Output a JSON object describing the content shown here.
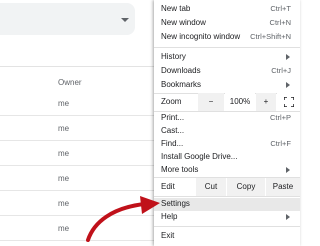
{
  "background": {
    "owner_header": "Owner",
    "rows": [
      "me",
      "me",
      "me",
      "me",
      "me",
      "me"
    ]
  },
  "menu": {
    "new_tab": {
      "label": "New tab",
      "shortcut": "Ctrl+T"
    },
    "new_window": {
      "label": "New window",
      "shortcut": "Ctrl+N"
    },
    "new_incognito": {
      "label": "New incognito window",
      "shortcut": "Ctrl+Shift+N"
    },
    "history": {
      "label": "History"
    },
    "downloads": {
      "label": "Downloads",
      "shortcut": "Ctrl+J"
    },
    "bookmarks": {
      "label": "Bookmarks"
    },
    "zoom": {
      "label": "Zoom",
      "minus": "−",
      "value": "100%",
      "plus": "+"
    },
    "print": {
      "label": "Print...",
      "shortcut": "Ctrl+P"
    },
    "cast": {
      "label": "Cast..."
    },
    "find": {
      "label": "Find...",
      "shortcut": "Ctrl+F"
    },
    "install": {
      "label": "Install Google Drive..."
    },
    "more_tools": {
      "label": "More tools"
    },
    "edit": {
      "label": "Edit",
      "cut": "Cut",
      "copy": "Copy",
      "paste": "Paste"
    },
    "settings": {
      "label": "Settings"
    },
    "help": {
      "label": "Help"
    },
    "exit": {
      "label": "Exit"
    }
  },
  "colors": {
    "arrow": "#c0111a",
    "highlight": "#e8e8e8"
  }
}
